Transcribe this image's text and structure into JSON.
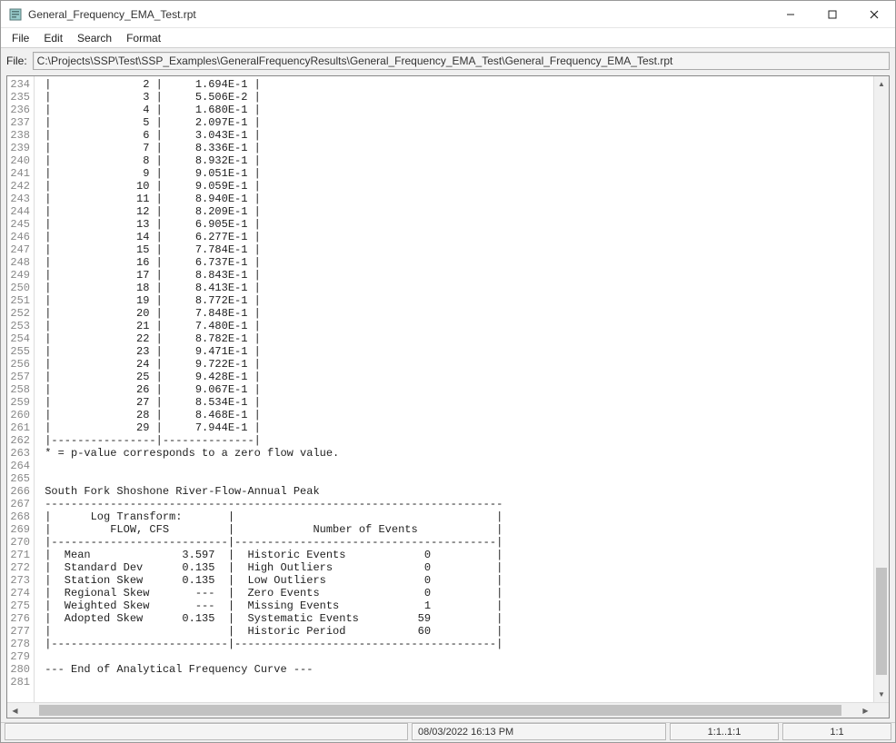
{
  "window": {
    "title": "General_Frequency_EMA_Test.rpt"
  },
  "menu": {
    "items": [
      "File",
      "Edit",
      "Search",
      "Format"
    ]
  },
  "filebar": {
    "label": "File:",
    "path": "C:\\Projects\\SSP\\Test\\SSP_Examples\\GeneralFrequencyResults\\General_Frequency_EMA_Test\\General_Frequency_EMA_Test.rpt"
  },
  "report": {
    "first_line_no": 234,
    "lines": [
      " |              2 |     1.694E-1 |",
      " |              3 |     5.506E-2 |",
      " |              4 |     1.680E-1 |",
      " |              5 |     2.097E-1 |",
      " |              6 |     3.043E-1 |",
      " |              7 |     8.336E-1 |",
      " |              8 |     8.932E-1 |",
      " |              9 |     9.051E-1 |",
      " |             10 |     9.059E-1 |",
      " |             11 |     8.940E-1 |",
      " |             12 |     8.209E-1 |",
      " |             13 |     6.905E-1 |",
      " |             14 |     6.277E-1 |",
      " |             15 |     7.784E-1 |",
      " |             16 |     6.737E-1 |",
      " |             17 |     8.843E-1 |",
      " |             18 |     8.413E-1 |",
      " |             19 |     8.772E-1 |",
      " |             20 |     7.848E-1 |",
      " |             21 |     7.480E-1 |",
      " |             22 |     8.782E-1 |",
      " |             23 |     9.471E-1 |",
      " |             24 |     9.722E-1 |",
      " |             25 |     9.428E-1 |",
      " |             26 |     9.067E-1 |",
      " |             27 |     8.534E-1 |",
      " |             28 |     8.468E-1 |",
      " |             29 |     7.944E-1 |",
      " |----------------|--------------|",
      " * = p-value corresponds to a zero flow value.",
      " ",
      " ",
      " South Fork Shoshone River-Flow-Annual Peak",
      " ----------------------------------------------------------------------",
      " |      Log Transform:       |                                        |",
      " |         FLOW, CFS         |            Number of Events            |",
      " |---------------------------|----------------------------------------|",
      " |  Mean              3.597  |  Historic Events            0          |",
      " |  Standard Dev      0.135  |  High Outliers              0          |",
      " |  Station Skew      0.135  |  Low Outliers               0          |",
      " |  Regional Skew       ---  |  Zero Events                0          |",
      " |  Weighted Skew       ---  |  Missing Events             1          |",
      " |  Adopted Skew      0.135  |  Systematic Events         59          |",
      " |                           |  Historic Period           60          |",
      " |---------------------------|----------------------------------------|",
      " ",
      " --- End of Analytical Frequency Curve ---",
      " "
    ]
  },
  "status": {
    "left": "",
    "datetime": "08/03/2022 16:13 PM",
    "pos": "1:1..1:1",
    "zoom": "1:1"
  },
  "scroll": {
    "vthumb_top_pct": 80,
    "vthumb_height_pct": 18,
    "hthumb_left_pct": 2,
    "hthumb_width_pct": 96
  }
}
